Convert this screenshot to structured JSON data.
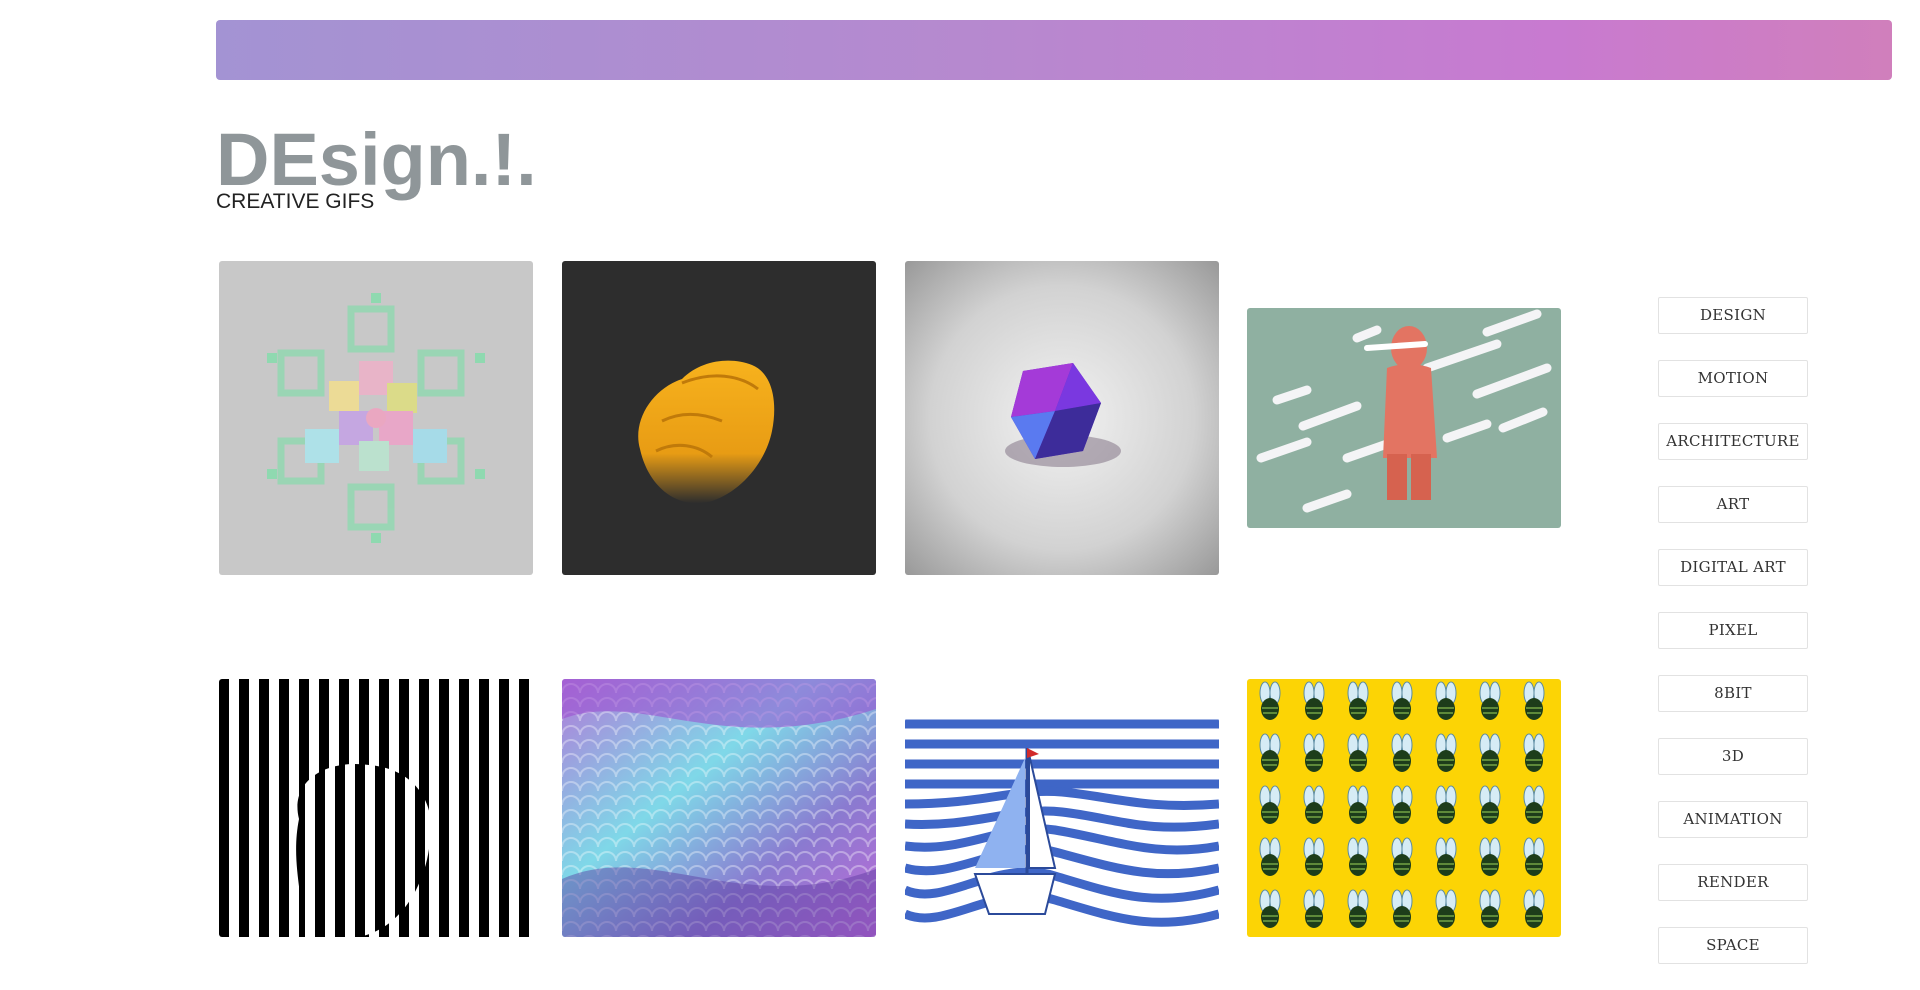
{
  "site": {
    "title": "DEsign.!.",
    "subtitle": "CREATIVE GIFS"
  },
  "colors": {
    "banner_gradient": [
      "#a393d3",
      "#c87ad0",
      "#d07fbc"
    ],
    "title": "#8f9699"
  },
  "gallery": [
    {
      "icon": "isometric-cubes-snowflake-image"
    },
    {
      "icon": "yellow-fist-image"
    },
    {
      "icon": "purple-crystal-image"
    },
    {
      "icon": "pink-figure-in-rain-image"
    },
    {
      "icon": "striped-face-illusion-image"
    },
    {
      "icon": "sequin-waves-image"
    },
    {
      "icon": "sailboat-on-striped-waves-image"
    },
    {
      "icon": "bee-pattern-image"
    }
  ],
  "categories": [
    "DESIGN",
    "MOTION",
    "ARCHITECTURE",
    "ART",
    "DIGITAL ART",
    "PIXEL",
    "8BIT",
    "3D",
    "ANIMATION",
    "RENDER",
    "SPACE"
  ]
}
